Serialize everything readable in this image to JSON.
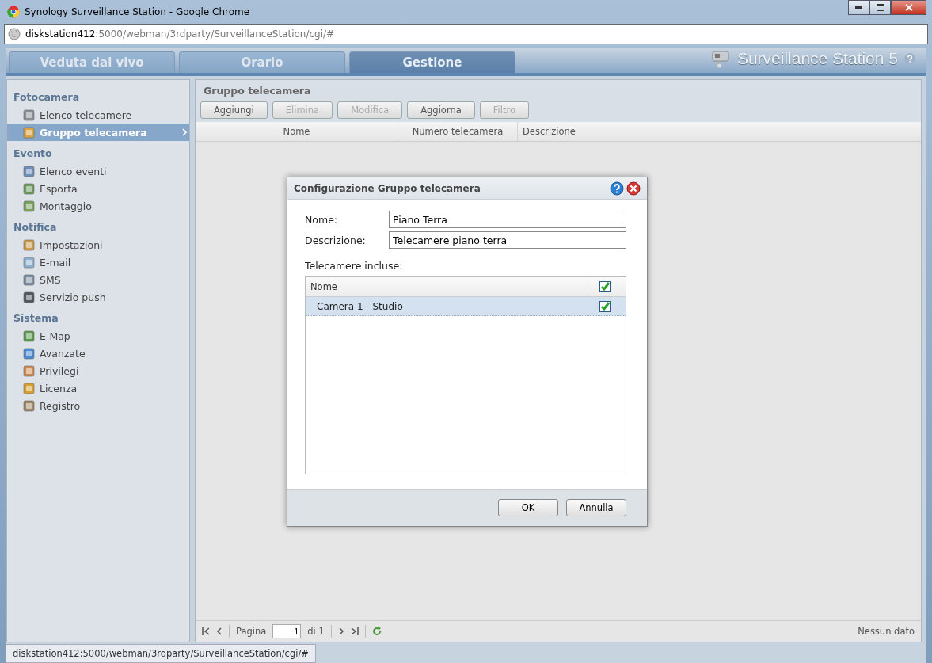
{
  "window": {
    "title": "Synology Surveillance Station - Google Chrome"
  },
  "address": {
    "host": "diskstation412",
    "path": ":5000/webman/3rdparty/SurveillanceStation/cgi/#"
  },
  "tabs": [
    {
      "label": "Veduta dal vivo",
      "selected": false
    },
    {
      "label": "Orario",
      "selected": false
    },
    {
      "label": "Gestione",
      "selected": true
    }
  ],
  "app_title": "Surveillance Station 5",
  "sidebar": {
    "sections": [
      {
        "title": "Fotocamera",
        "items": [
          {
            "label": "Elenco telecamere",
            "selected": false
          },
          {
            "label": "Gruppo telecamera",
            "selected": true
          }
        ]
      },
      {
        "title": "Evento",
        "items": [
          {
            "label": "Elenco eventi",
            "selected": false
          },
          {
            "label": "Esporta",
            "selected": false
          },
          {
            "label": "Montaggio",
            "selected": false
          }
        ]
      },
      {
        "title": "Notifica",
        "items": [
          {
            "label": "Impostazioni",
            "selected": false
          },
          {
            "label": "E-mail",
            "selected": false
          },
          {
            "label": "SMS",
            "selected": false
          },
          {
            "label": "Servizio push",
            "selected": false
          }
        ]
      },
      {
        "title": "Sistema",
        "items": [
          {
            "label": "E-Map",
            "selected": false
          },
          {
            "label": "Avanzate",
            "selected": false
          },
          {
            "label": "Privilegi",
            "selected": false
          },
          {
            "label": "Licenza",
            "selected": false
          },
          {
            "label": "Registro",
            "selected": false
          }
        ]
      }
    ]
  },
  "panel": {
    "title": "Gruppo telecamera",
    "toolbar": [
      {
        "label": "Aggiungi",
        "disabled": false
      },
      {
        "label": "Elimina",
        "disabled": true
      },
      {
        "label": "Modifica",
        "disabled": true
      },
      {
        "label": "Aggiorna",
        "disabled": false
      },
      {
        "label": "Filtro",
        "disabled": true
      }
    ],
    "columns": [
      "Nome",
      "Numero telecamera",
      "Descrizione"
    ],
    "pagination": {
      "label": "Pagina",
      "page": "1",
      "total": "di 1"
    },
    "status": "Nessun dato"
  },
  "dialog": {
    "title": "Configurazione Gruppo telecamera",
    "fields": [
      {
        "label": "Nome:",
        "value": "Piano Terra"
      },
      {
        "label": "Descrizione:",
        "value": "Telecamere piano terra"
      }
    ],
    "list_label": "Telecamere incluse:",
    "list": {
      "column": "Nome",
      "header_checked": true,
      "rows": [
        {
          "label": "Camera 1 - Studio",
          "checked": true,
          "selected": true
        }
      ]
    },
    "buttons": [
      "OK",
      "Annulla"
    ]
  },
  "status_url": "diskstation412:5000/webman/3rdparty/SurveillanceStation/cgi/#"
}
